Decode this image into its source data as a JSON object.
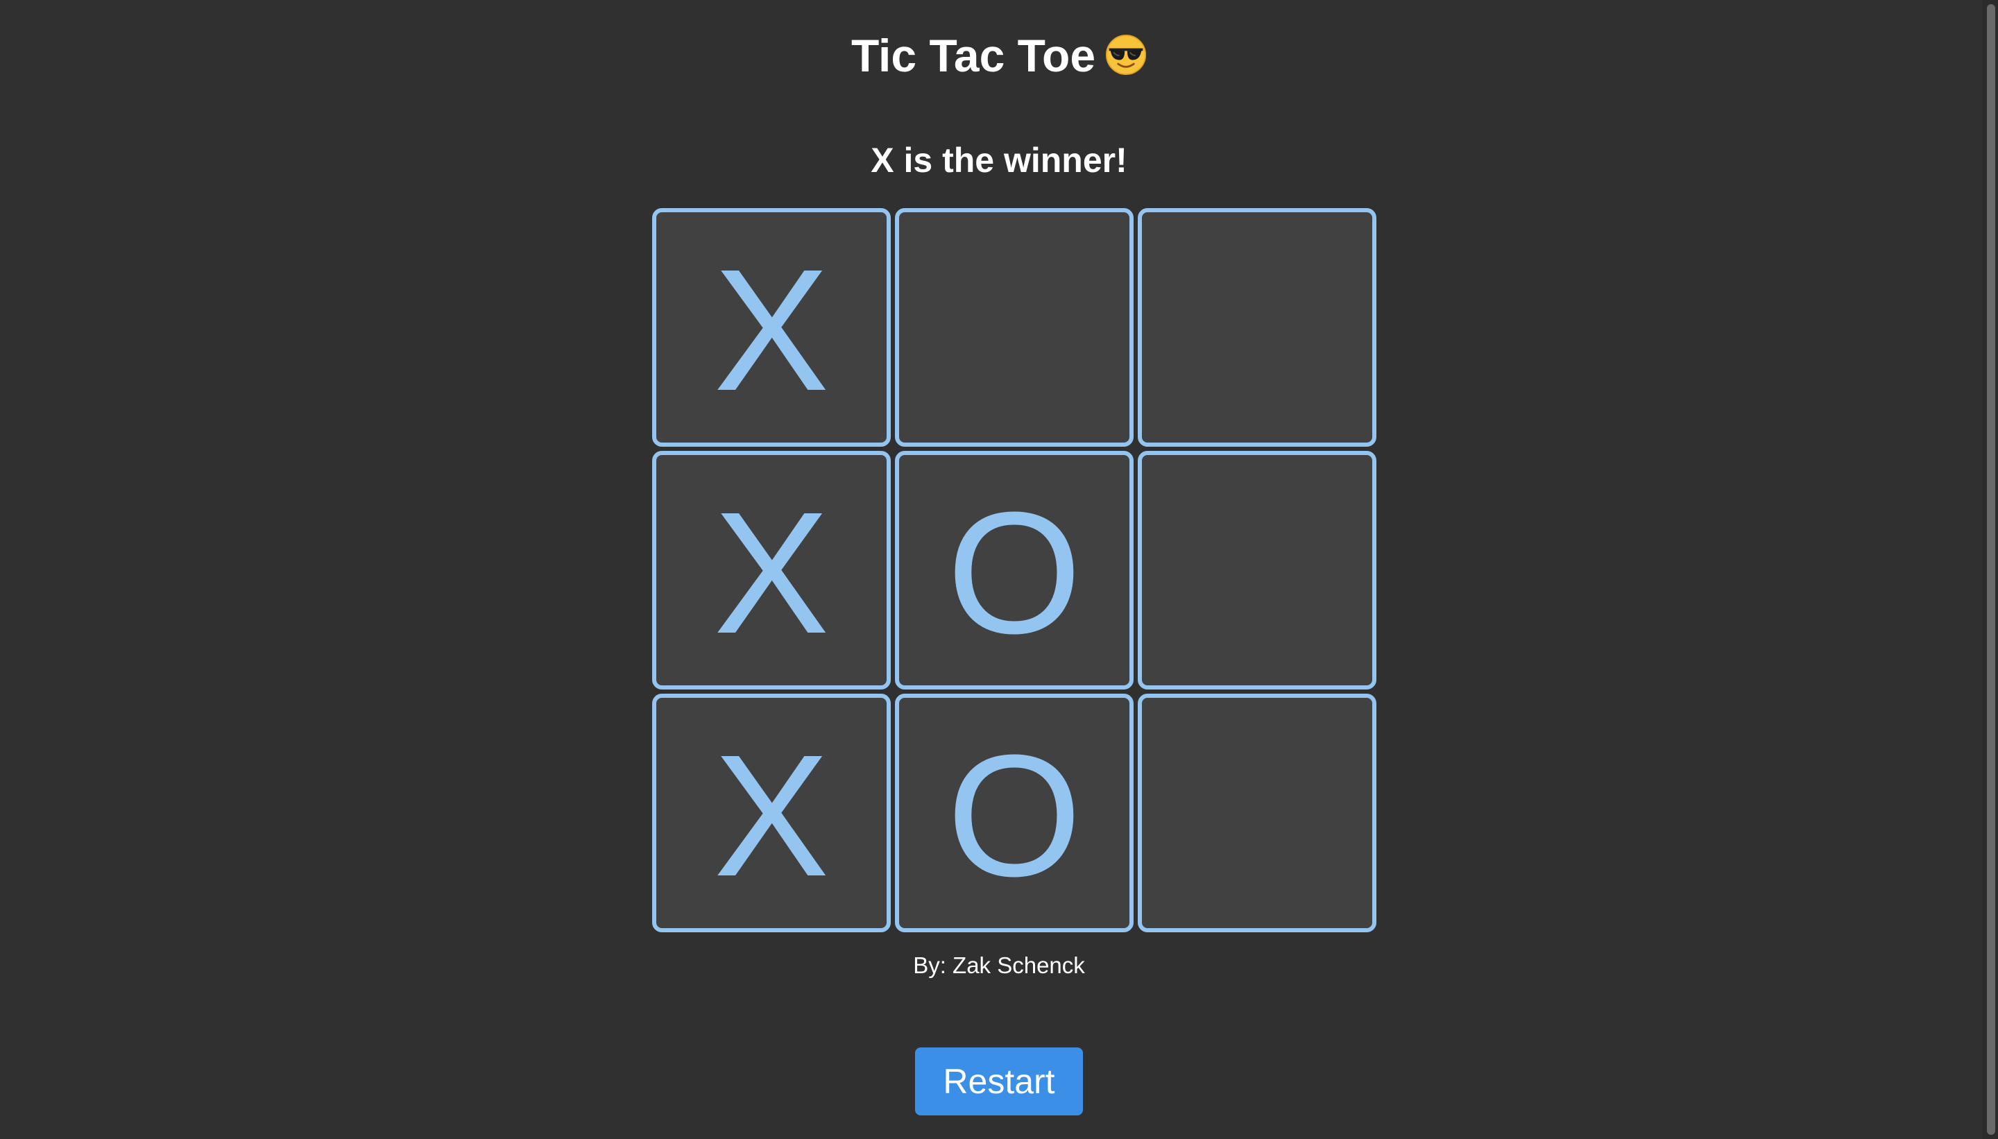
{
  "header": {
    "title": "Tic Tac Toe",
    "emoji_icon": "smiling-face-with-sunglasses-icon"
  },
  "status": "X is the winner!",
  "board": {
    "cells": [
      "X",
      "",
      "",
      "X",
      "O",
      "",
      "X",
      "O",
      ""
    ]
  },
  "footer": {
    "author": "By: Zak Schenck"
  },
  "controls": {
    "restart_label": "Restart"
  },
  "colors": {
    "background": "#303030",
    "cell_background": "#414141",
    "accent": "#93c5f0",
    "button": "#3c8fe6"
  }
}
